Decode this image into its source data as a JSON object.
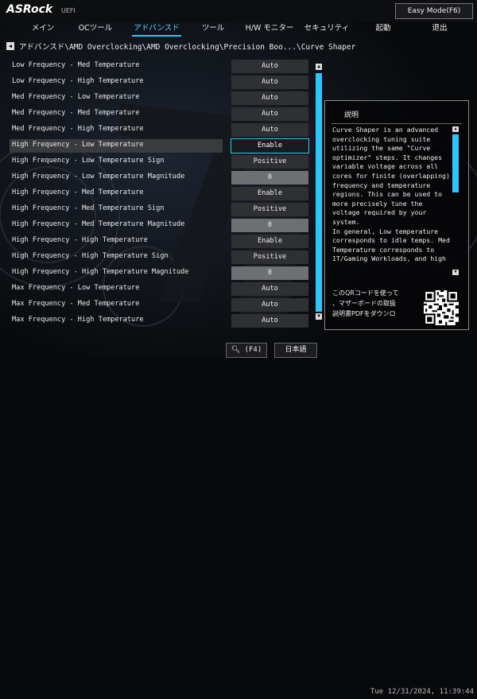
{
  "header": {
    "brand": "ASRock",
    "brand_suffix": "UEFI",
    "easy_mode_label": "Easy Mode(F6)"
  },
  "menu": [
    {
      "label": "メイン",
      "active": false
    },
    {
      "label": "OCツール",
      "active": false
    },
    {
      "label": "アドバンスド",
      "active": true
    },
    {
      "label": "ツール",
      "active": false
    },
    {
      "label": "H/W モニター",
      "active": false
    },
    {
      "label": "セキュリティ",
      "active": false
    },
    {
      "label": "起動",
      "active": false
    },
    {
      "label": "退出",
      "active": false
    }
  ],
  "breadcrumb": "アドバンスド\\AMD Overclocking\\AMD Overclocking\\Precision Boo...\\Curve Shaper",
  "settings": [
    {
      "label": "Low Frequency - Med Temperature",
      "value": "Auto"
    },
    {
      "label": "Low Frequency - High Temperature",
      "value": "Auto"
    },
    {
      "label": "Med Frequency - Low Temperature",
      "value": "Auto"
    },
    {
      "label": "Med Frequency - Med Temperature",
      "value": "Auto"
    },
    {
      "label": "Med Frequency - High Temperature",
      "value": "Auto"
    },
    {
      "label": "High Frequency - Low Temperature",
      "value": "Enable",
      "selected": true
    },
    {
      "label": "High Frequency - Low Temperature Sign",
      "value": "Positive"
    },
    {
      "label": "High Frequency - Low Temperature Magnitude",
      "value": "0",
      "numeric": true
    },
    {
      "label": "High Frequency - Med Temperature",
      "value": "Enable"
    },
    {
      "label": "High Frequency - Med Temperature Sign",
      "value": "Positive"
    },
    {
      "label": "High Frequency - Med Temperature Magnitude",
      "value": "0",
      "numeric": true
    },
    {
      "label": "High Frequency - High Temperature",
      "value": "Enable"
    },
    {
      "label": "High Frequency - High Temperature Sign",
      "value": "Positive"
    },
    {
      "label": "High Frequency - High Temperature Magnitude",
      "value": "0",
      "numeric": true
    },
    {
      "label": "Max Frequency - Low Temperature",
      "value": "Auto"
    },
    {
      "label": "Max Frequency - Med Temperature",
      "value": "Auto"
    },
    {
      "label": "Max Frequency - High Temperature",
      "value": "Auto"
    }
  ],
  "help": {
    "title": "説明",
    "lines": [
      "Curve Shaper is an advanced",
      "overclocking tuning suite",
      "utilizing the same \"Curve",
      "optimizer\" steps. It changes",
      "variable voltage across all",
      "cores for finite (overlapping)",
      "frequency and temperature",
      "regions. This can be used to",
      "more precisely tune the",
      "voltage required by your",
      "system.",
      "In general, Low temperature",
      "corresponds to idle temps. Med",
      "Temperature corresponds to",
      "1T/Gaming Workloads, and high"
    ],
    "qr_lines": [
      "このQRコードを使って",
      "、マザーボードの取扱",
      "説明書PDFをダウンロ"
    ]
  },
  "footer": {
    "search_label": "(F4)",
    "language_label": "日本語",
    "datetime": "Tue 12/31/2024, 11:39:44"
  },
  "colors": {
    "accent": "#2cc6ff",
    "background": "#08090b"
  },
  "icons": {
    "search": "magnifier-icon",
    "back": "back-arrow-icon"
  }
}
